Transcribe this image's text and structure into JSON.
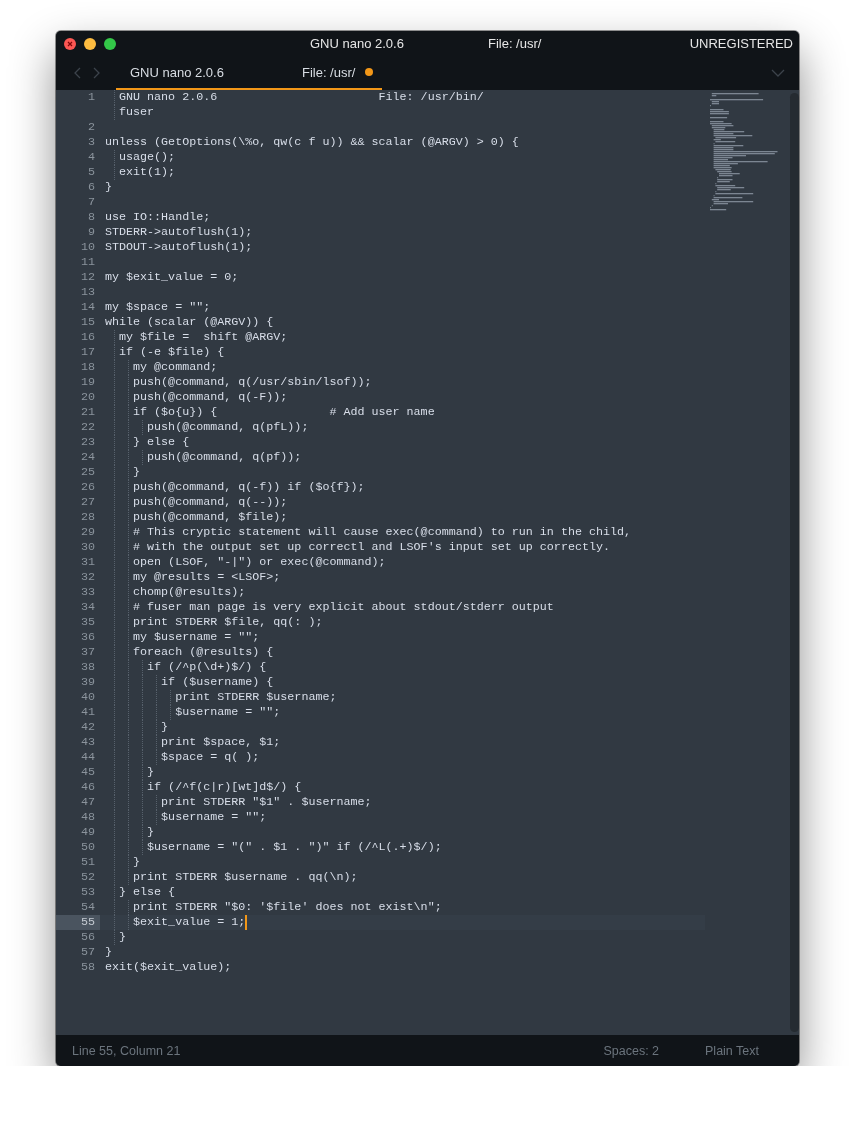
{
  "window": {
    "title": [
      "GNU nano 2.0.6",
      "File: /usr/"
    ],
    "license": "UNREGISTERED"
  },
  "tabs": [
    {
      "label": [
        "GNU nano 2.0.6",
        "File: /usr/"
      ],
      "selected": true,
      "dirty": true
    }
  ],
  "editor": {
    "lines": [
      {
        "number": "1",
        "text": "  GNU nano 2.0.6                       File: /usr/bin/",
        "continuation": "  fuser",
        "current": false
      },
      {
        "number": "2",
        "current": false
      },
      {
        "number": "3",
        "text": "unless (GetOptions(\\%o, qw(c f u)) && scalar (@ARGV) > 0) {",
        "current": false
      },
      {
        "number": "4",
        "text": "  usage();",
        "current": false
      },
      {
        "number": "5",
        "text": "  exit(1);",
        "current": false
      },
      {
        "number": "6",
        "text": "}",
        "current": false
      },
      {
        "number": "7",
        "current": false
      },
      {
        "number": "8",
        "text": "use IO::Handle;",
        "current": false
      },
      {
        "number": "9",
        "text": "STDERR->autoflush(1);",
        "current": false
      },
      {
        "number": "10",
        "text": "STDOUT->autoflush(1);",
        "current": false
      },
      {
        "number": "11",
        "current": false
      },
      {
        "number": "12",
        "text": "my $exit_value = 0;",
        "current": false
      },
      {
        "number": "13",
        "current": false
      },
      {
        "number": "14",
        "text": "my $space = \"\";",
        "current": false
      },
      {
        "number": "15",
        "text": "while (scalar (@ARGV)) {",
        "current": false
      },
      {
        "number": "16",
        "text": "  my $file =  shift @ARGV;",
        "current": false
      },
      {
        "number": "17",
        "text": "  if (-e $file) {",
        "current": false
      },
      {
        "number": "18",
        "text": "    my @command;",
        "current": false
      },
      {
        "number": "19",
        "text": "    push(@command, q(/usr/sbin/lsof));",
        "current": false
      },
      {
        "number": "20",
        "text": "    push(@command, q(-F));",
        "current": false
      },
      {
        "number": "21",
        "text": "    if ($o{u}) {                # Add user name",
        "current": false
      },
      {
        "number": "22",
        "text": "      push(@command, q(pfL));",
        "current": false
      },
      {
        "number": "23",
        "text": "    } else {",
        "current": false
      },
      {
        "number": "24",
        "text": "      push(@command, q(pf));",
        "current": false
      },
      {
        "number": "25",
        "text": "    }",
        "current": false
      },
      {
        "number": "26",
        "text": "    push(@command, q(-f)) if ($o{f});",
        "current": false
      },
      {
        "number": "27",
        "text": "    push(@command, q(--));",
        "current": false
      },
      {
        "number": "28",
        "text": "    push(@command, $file);",
        "current": false
      },
      {
        "number": "29",
        "text": "    # This cryptic statement will cause exec(@command) to run in the child,",
        "current": false
      },
      {
        "number": "30",
        "text": "    # with the output set up correctl and LSOF's input set up correctly.",
        "current": false
      },
      {
        "number": "31",
        "text": "    open (LSOF, \"-|\") or exec(@command);",
        "current": false
      },
      {
        "number": "32",
        "text": "    my @results = <LSOF>;",
        "current": false
      },
      {
        "number": "33",
        "text": "    chomp(@results);",
        "current": false
      },
      {
        "number": "34",
        "text": "    # fuser man page is very explicit about stdout/stderr output",
        "current": false
      },
      {
        "number": "35",
        "text": "    print STDERR $file, qq(: );",
        "current": false
      },
      {
        "number": "36",
        "text": "    my $username = \"\";",
        "current": false
      },
      {
        "number": "37",
        "text": "    foreach (@results) {",
        "current": false
      },
      {
        "number": "38",
        "text": "      if (/^p(\\d+)$/) {",
        "current": false
      },
      {
        "number": "39",
        "text": "        if ($username) {",
        "current": false
      },
      {
        "number": "40",
        "text": "          print STDERR $username;",
        "current": false
      },
      {
        "number": "41",
        "text": "          $username = \"\";",
        "current": false
      },
      {
        "number": "42",
        "text": "        }",
        "current": false
      },
      {
        "number": "43",
        "text": "        print $space, $1;",
        "current": false
      },
      {
        "number": "44",
        "text": "        $space = q( );",
        "current": false
      },
      {
        "number": "45",
        "text": "      }",
        "current": false
      },
      {
        "number": "46",
        "text": "      if (/^f(c|r)[wt]d$/) {",
        "current": false
      },
      {
        "number": "47",
        "text": "        print STDERR \"$1\" . $username;",
        "current": false
      },
      {
        "number": "48",
        "text": "        $username = \"\";",
        "current": false
      },
      {
        "number": "49",
        "text": "      }",
        "current": false
      },
      {
        "number": "50",
        "text": "      $username = \"(\" . $1 . \")\" if (/^L(.+)$/);",
        "current": false
      },
      {
        "number": "51",
        "text": "    }",
        "current": false
      },
      {
        "number": "52",
        "text": "    print STDERR $username . qq(\\n);",
        "current": false
      },
      {
        "number": "53",
        "text": "  } else {",
        "current": false
      },
      {
        "number": "54",
        "text": "    print STDERR \"$0: '$file' does not exist\\n\";",
        "current": false
      },
      {
        "number": "55",
        "text": "    $exit_value = 1;",
        "current": true
      },
      {
        "number": "56",
        "text": "  }",
        "current": false
      },
      {
        "number": "57",
        "text": "}",
        "current": false
      },
      {
        "number": "58",
        "text": "exit($exit_value);",
        "current": false
      }
    ]
  },
  "status_bar": {
    "position": "Line 55, Column 21",
    "indentation": "Spaces: 2",
    "syntax": "Plain Text"
  }
}
